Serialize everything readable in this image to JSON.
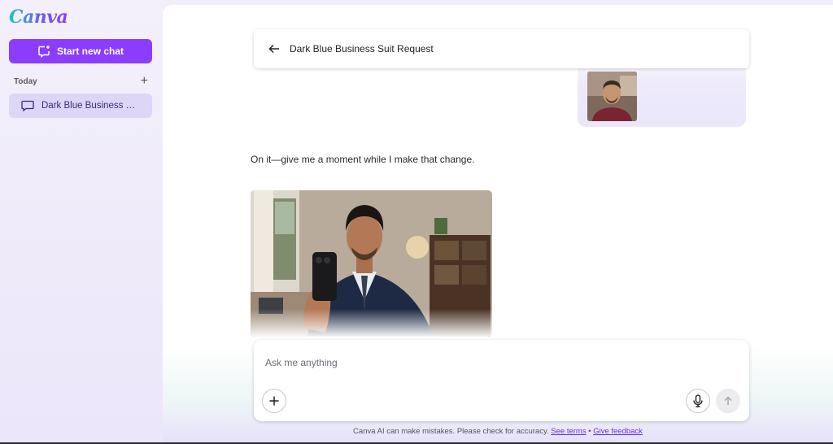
{
  "sidebar": {
    "logo_text": "Canva",
    "new_chat_label": "Start new chat",
    "section_label": "Today",
    "chats": [
      {
        "label": "Dark Blue Business Suit Request"
      }
    ]
  },
  "header": {
    "title": "Dark Blue Business Suit Request"
  },
  "conversation": {
    "assistant_message": "On it—give me a moment while I make that change."
  },
  "composer": {
    "placeholder": "Ask me anything"
  },
  "footer": {
    "disclaimer": "Canva AI can make mistakes. Please check for accuracy.",
    "separator": "•",
    "terms_link": "See terms",
    "feedback_link": "Give feedback"
  },
  "colors": {
    "accent": "#8b3dff",
    "sidebar_bg": "#f0ecfb",
    "selected_item_bg": "#ddd6f6"
  }
}
